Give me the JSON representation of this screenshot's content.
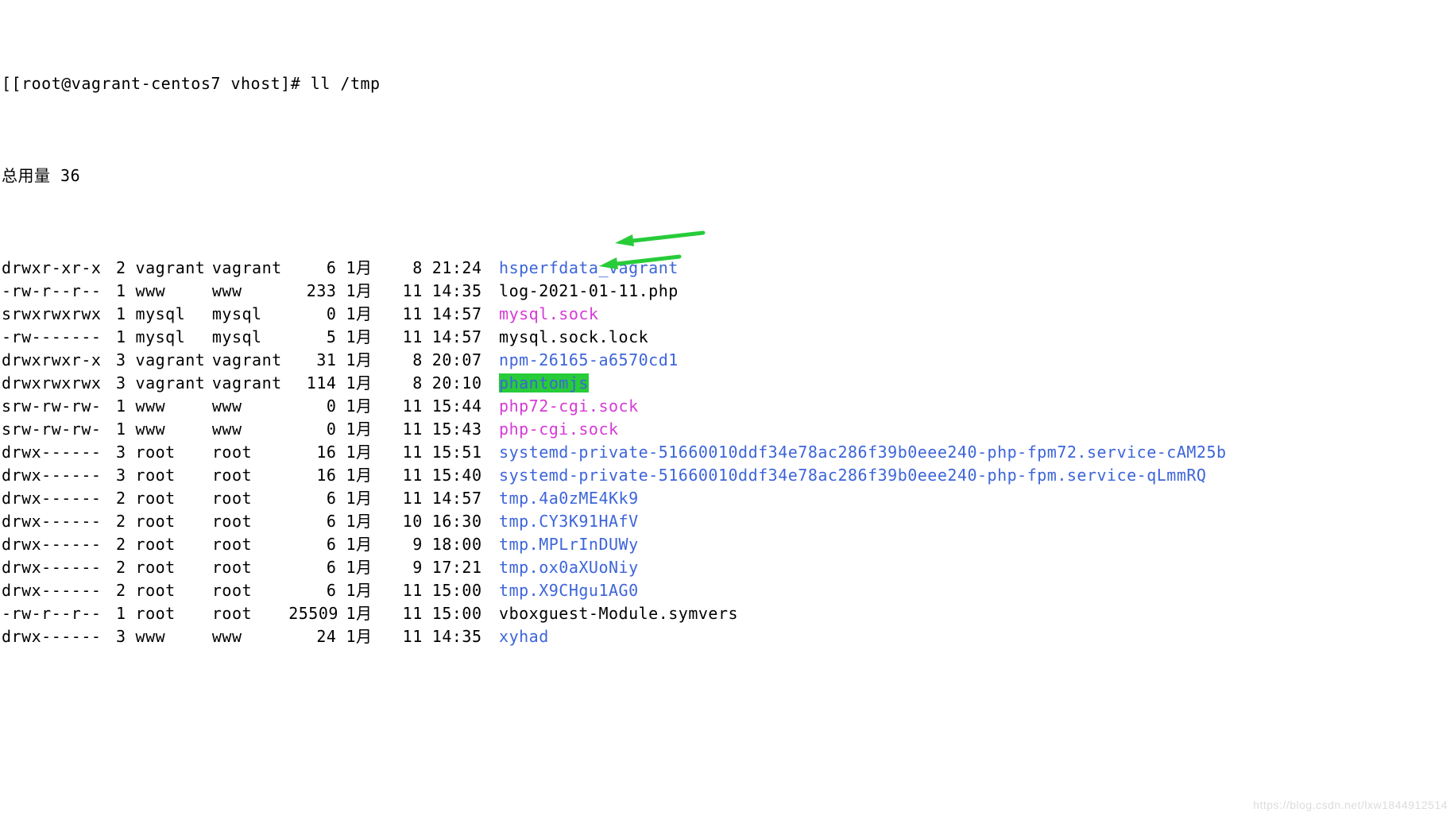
{
  "prompt": {
    "bracket": "[",
    "user_host": "[root@vagrant-centos7 vhost]# ",
    "command": "ll /tmp"
  },
  "total_line": "总用量 36",
  "watermark": "https://blog.csdn.net/lxw1844912514",
  "rows": [
    {
      "perm": "drwxr-xr-x",
      "links": "2",
      "owner": "vagrant",
      "group": "vagrant",
      "size": "6",
      "month": "1月",
      "day": "8",
      "time": "21:24",
      "name": "hsperfdata_vagrant",
      "cls": "c-dir"
    },
    {
      "perm": "-rw-r--r--",
      "links": "1",
      "owner": "www",
      "group": "www",
      "size": "233",
      "month": "1月",
      "day": "11",
      "time": "14:35",
      "name": "log-2021-01-11.php",
      "cls": "c-plain"
    },
    {
      "perm": "srwxrwxrwx",
      "links": "1",
      "owner": "mysql",
      "group": "mysql",
      "size": "0",
      "month": "1月",
      "day": "11",
      "time": "14:57",
      "name": "mysql.sock",
      "cls": "c-sock"
    },
    {
      "perm": "-rw-------",
      "links": "1",
      "owner": "mysql",
      "group": "mysql",
      "size": "5",
      "month": "1月",
      "day": "11",
      "time": "14:57",
      "name": "mysql.sock.lock",
      "cls": "c-plain"
    },
    {
      "perm": "drwxrwxr-x",
      "links": "3",
      "owner": "vagrant",
      "group": "vagrant",
      "size": "31",
      "month": "1月",
      "day": "8",
      "time": "20:07",
      "name": "npm-26165-a6570cd1",
      "cls": "c-dir"
    },
    {
      "perm": "drwxrwxrwx",
      "links": "3",
      "owner": "vagrant",
      "group": "vagrant",
      "size": "114",
      "month": "1月",
      "day": "8",
      "time": "20:10",
      "name": "phantomjs",
      "cls": "c-sticky"
    },
    {
      "perm": "srw-rw-rw-",
      "links": "1",
      "owner": "www",
      "group": "www",
      "size": "0",
      "month": "1月",
      "day": "11",
      "time": "15:44",
      "name": "php72-cgi.sock",
      "cls": "c-sock"
    },
    {
      "perm": "srw-rw-rw-",
      "links": "1",
      "owner": "www",
      "group": "www",
      "size": "0",
      "month": "1月",
      "day": "11",
      "time": "15:43",
      "name": "php-cgi.sock",
      "cls": "c-sock"
    },
    {
      "perm": "drwx------",
      "links": "3",
      "owner": "root",
      "group": "root",
      "size": "16",
      "month": "1月",
      "day": "11",
      "time": "15:51",
      "name": "systemd-private-51660010ddf34e78ac286f39b0eee240-php-fpm72.service-cAM25b",
      "cls": "c-dir"
    },
    {
      "perm": "drwx------",
      "links": "3",
      "owner": "root",
      "group": "root",
      "size": "16",
      "month": "1月",
      "day": "11",
      "time": "15:40",
      "name": "systemd-private-51660010ddf34e78ac286f39b0eee240-php-fpm.service-qLmmRQ",
      "cls": "c-dir"
    },
    {
      "perm": "drwx------",
      "links": "2",
      "owner": "root",
      "group": "root",
      "size": "6",
      "month": "1月",
      "day": "11",
      "time": "14:57",
      "name": "tmp.4a0zME4Kk9",
      "cls": "c-dir"
    },
    {
      "perm": "drwx------",
      "links": "2",
      "owner": "root",
      "group": "root",
      "size": "6",
      "month": "1月",
      "day": "10",
      "time": "16:30",
      "name": "tmp.CY3K91HAfV",
      "cls": "c-dir"
    },
    {
      "perm": "drwx------",
      "links": "2",
      "owner": "root",
      "group": "root",
      "size": "6",
      "month": "1月",
      "day": "9",
      "time": "18:00",
      "name": "tmp.MPLrInDUWy",
      "cls": "c-dir"
    },
    {
      "perm": "drwx------",
      "links": "2",
      "owner": "root",
      "group": "root",
      "size": "6",
      "month": "1月",
      "day": "9",
      "time": "17:21",
      "name": "tmp.ox0aXUoNiy",
      "cls": "c-dir"
    },
    {
      "perm": "drwx------",
      "links": "2",
      "owner": "root",
      "group": "root",
      "size": "6",
      "month": "1月",
      "day": "11",
      "time": "15:00",
      "name": "tmp.X9CHgu1AG0",
      "cls": "c-dir"
    },
    {
      "perm": "-rw-r--r--",
      "links": "1",
      "owner": "root",
      "group": "root",
      "size": "25509",
      "month": "1月",
      "day": "11",
      "time": "15:00",
      "name": "vboxguest-Module.symvers",
      "cls": "c-plain"
    },
    {
      "perm": "drwx------",
      "links": "3",
      "owner": "www",
      "group": "www",
      "size": "24",
      "month": "1月",
      "day": "11",
      "time": "14:35",
      "name": "xyhad",
      "cls": "c-dir"
    }
  ]
}
